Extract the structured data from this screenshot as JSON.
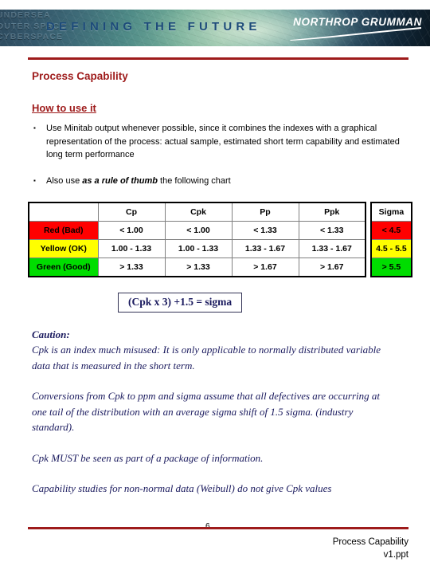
{
  "banner": {
    "ghost_lines": [
      "UNDERSEA",
      "OUTER SPACE",
      "CYBERSPACE"
    ],
    "tagline": "DEFINING THE FUTURE",
    "logo_text": "NORTHROP GRUMMAN",
    "accent_color": "#1d4b7a"
  },
  "slide": {
    "title": "Process Capability",
    "subtitle": "How to use it",
    "accent_color": "#9E1B1B"
  },
  "bullets": [
    {
      "pre": "Use Minitab output whenever possible, since it combines the indexes with a graphical representation of the process: actual sample, estimated short term capability and estimated long term performance",
      "emphasis": "",
      "post": ""
    },
    {
      "pre": "Also use ",
      "emphasis": "as a rule of thumb",
      "post": " the following chart"
    }
  ],
  "table": {
    "headers": [
      "",
      "Cp",
      "Cpk",
      "Pp",
      "Ppk"
    ],
    "sigma_header": "Sigma",
    "rows": [
      {
        "label": "Red (Bad)",
        "color": "#FF0000",
        "values": [
          "< 1.00",
          "< 1.00",
          "< 1.33",
          "< 1.33"
        ],
        "sigma": "< 4.5"
      },
      {
        "label": "Yellow (OK)",
        "color": "#FFFF00",
        "values": [
          "1.00 - 1.33",
          "1.00 - 1.33",
          "1.33 - 1.67",
          "1.33 - 1.67"
        ],
        "sigma": "4.5 - 5.5"
      },
      {
        "label": "Green (Good)",
        "color": "#00DD00",
        "values": [
          "> 1.33",
          "> 1.33",
          "> 1.67",
          "> 1.67"
        ],
        "sigma": "> 5.5"
      }
    ]
  },
  "formula": "(Cpk x 3) +1.5 = sigma",
  "notes": {
    "caution_label": "Caution:",
    "paragraphs": [
      "Cpk is an index much misused:  It is only applicable to normally distributed variable data that is measured in the short term.",
      "Conversions from Cpk to ppm and sigma assume that all defectives are occurring at one tail of the distribution with an average sigma shift of 1.5 sigma. (industry standard).",
      "Cpk MUST be seen as part of a package of information.",
      "Capability studies for non-normal data (Weibull)  do not give Cpk values"
    ]
  },
  "footer": {
    "page_number": "6",
    "doc_title": "Process Capability",
    "doc_version": "v1.ppt"
  }
}
